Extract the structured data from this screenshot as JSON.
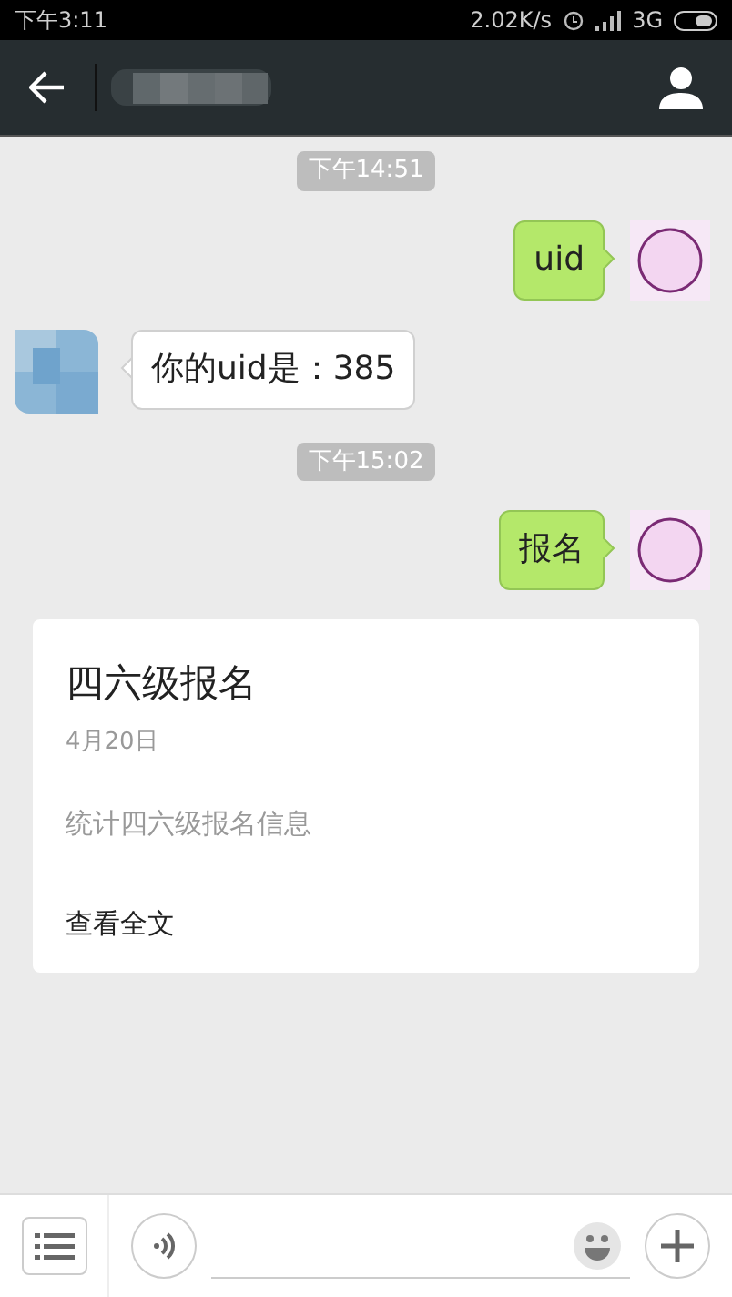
{
  "status_bar": {
    "time": "下午3:11",
    "speed": "2.02K/s",
    "network": "3G"
  },
  "messages": [
    {
      "kind": "time",
      "text": "下午14:51"
    },
    {
      "kind": "sent",
      "text": "uid"
    },
    {
      "kind": "received",
      "text": "你的uid是：385"
    },
    {
      "kind": "time",
      "text": "下午15:02"
    },
    {
      "kind": "sent",
      "text": "报名"
    },
    {
      "kind": "article",
      "title": "四六级报名",
      "date": "4月20日",
      "summary": "统计四六级报名信息",
      "link": "查看全文"
    }
  ]
}
